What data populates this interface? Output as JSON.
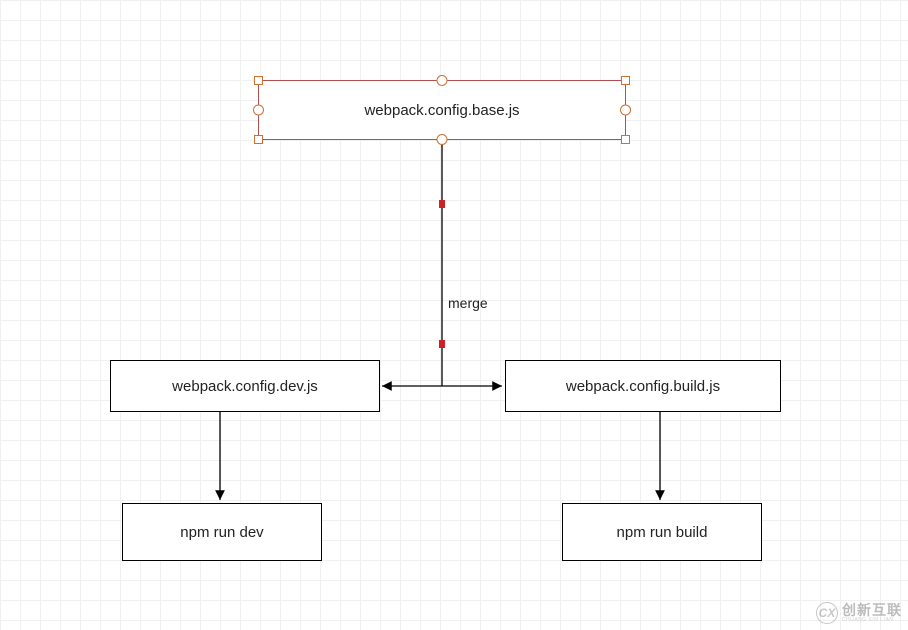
{
  "nodes": {
    "base": {
      "label": "webpack.config.base.js"
    },
    "dev": {
      "label": "webpack.config.dev.js"
    },
    "build": {
      "label": "webpack.config.build.js"
    },
    "run_dev": {
      "label": "npm run dev"
    },
    "run_build": {
      "label": "npm run build"
    }
  },
  "edges": {
    "merge_label": "merge"
  },
  "watermark": {
    "logo_text": "CX",
    "main": "创新互联",
    "sub": "CHUANG XIN LIAN"
  }
}
